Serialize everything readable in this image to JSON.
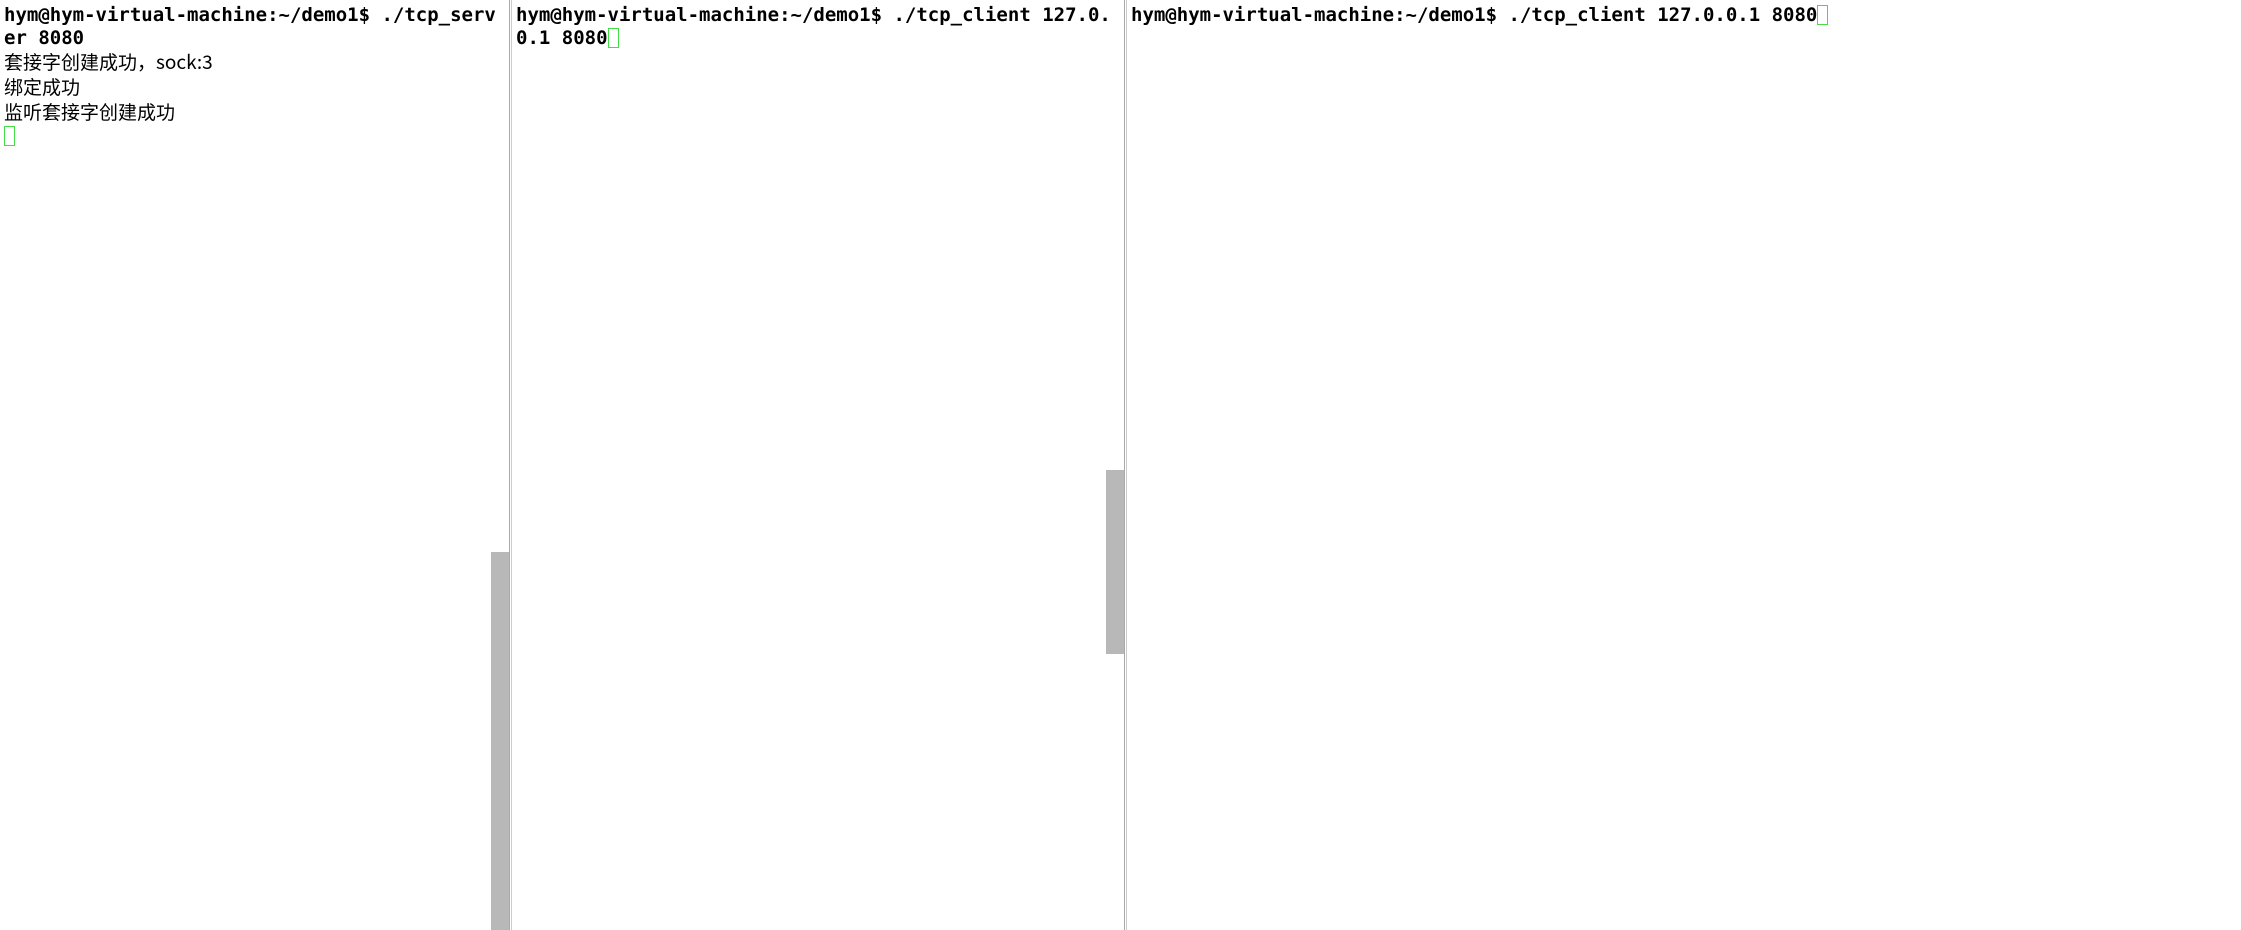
{
  "pane1": {
    "prompt": "hym@hym-virtual-machine:~/demo1$",
    "command": " ./tcp_server 8080",
    "out1": "套接字创建成功，sock:3",
    "out2": "绑定成功",
    "out3": "监听套接字创建成功"
  },
  "pane2": {
    "prompt": "hym@hym-virtual-machine:~/demo1$",
    "command": " ./tcp_client 127.0.0.1 8080"
  },
  "pane3": {
    "prompt": "hym@hym-virtual-machine:~/demo1$",
    "command": " ./tcp_client 127.0.0.1 8080"
  }
}
